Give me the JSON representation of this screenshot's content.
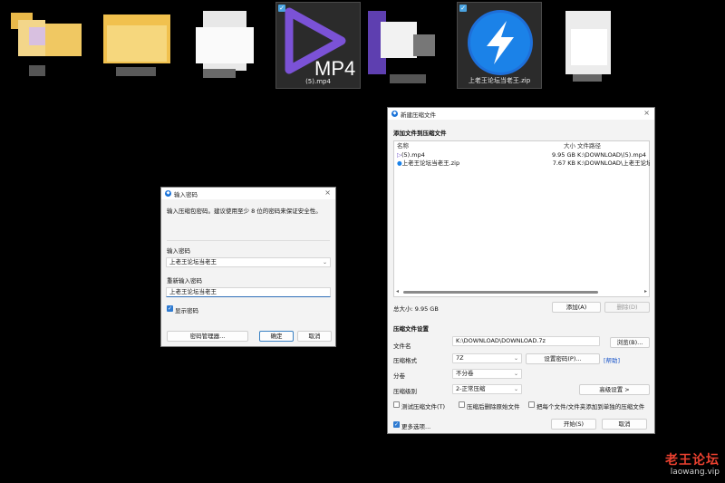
{
  "desktop": {
    "items": [
      {
        "label": "",
        "selected": false
      },
      {
        "label": "",
        "selected": false
      },
      {
        "label": "",
        "selected": false
      },
      {
        "label": "(5).mp4",
        "badge": "MP4",
        "selected": true
      },
      {
        "label": "",
        "selected": false
      },
      {
        "label": "上老王论坛当老王.zip",
        "selected": true
      },
      {
        "label": "",
        "selected": false
      }
    ]
  },
  "password_dialog": {
    "title": "输入密码",
    "instruction": "输入压缩包密码。建议使用至少 8 位的密码来保证安全性。",
    "enter_label": "输入密码",
    "enter_value": "上老王论坛当老王",
    "reenter_label": "重新输入密码",
    "reenter_value": "上老王论坛当老王",
    "show_password_label": "显示密码",
    "show_password_checked": true,
    "manager_button": "密码管理器...",
    "ok_button": "确定",
    "cancel_button": "取消"
  },
  "archive_dialog": {
    "title": "新建压缩文件",
    "add_section": "添加文件到压缩文件",
    "columns": {
      "name": "名称",
      "size": "大小",
      "path": "文件路径"
    },
    "files": [
      {
        "name": "(5).mp4",
        "size": "9.95 GB",
        "path": "K:\\DOWNLOAD\\(5).mp4",
        "icon": "video-file-icon"
      },
      {
        "name": "上老王论坛当老王.zip",
        "size": "7.67 KB",
        "path": "K:\\DOWNLOAD\\上老王论坛",
        "icon": "zip-file-icon"
      }
    ],
    "total_size": "总大小: 9.95 GB",
    "add_button": "添加(A)",
    "delete_button": "删除(D)",
    "settings_section": "压缩文件设置",
    "filename_label": "文件名",
    "filename_value": "K:\\DOWNLOAD\\DOWNLOAD.7z",
    "browse_button": "浏览(B)...",
    "format_label": "压缩格式",
    "format_value": "7Z",
    "set_password_button": "设置密码(P)...",
    "help_link": "[帮助]",
    "volume_label": "分卷",
    "volume_value": "不分卷",
    "level_label": "压缩级别",
    "level_value": "2-正常压缩",
    "advanced_button": "高级设置 >",
    "opt_test": "测试压缩文件(T)",
    "opt_delete": "压缩后删除原始文件",
    "opt_separate": "把每个文件/文件夹添加到单独的压缩文件",
    "more_options": "更多选项...",
    "start_button": "开始(S)",
    "cancel_button": "取消"
  },
  "watermark": {
    "cn": "老王论坛",
    "en": "laowang.vip"
  },
  "colors": {
    "accent": "#2f7bd1",
    "desktop_bg": "#000000",
    "watermark_red": "#e8402f"
  }
}
